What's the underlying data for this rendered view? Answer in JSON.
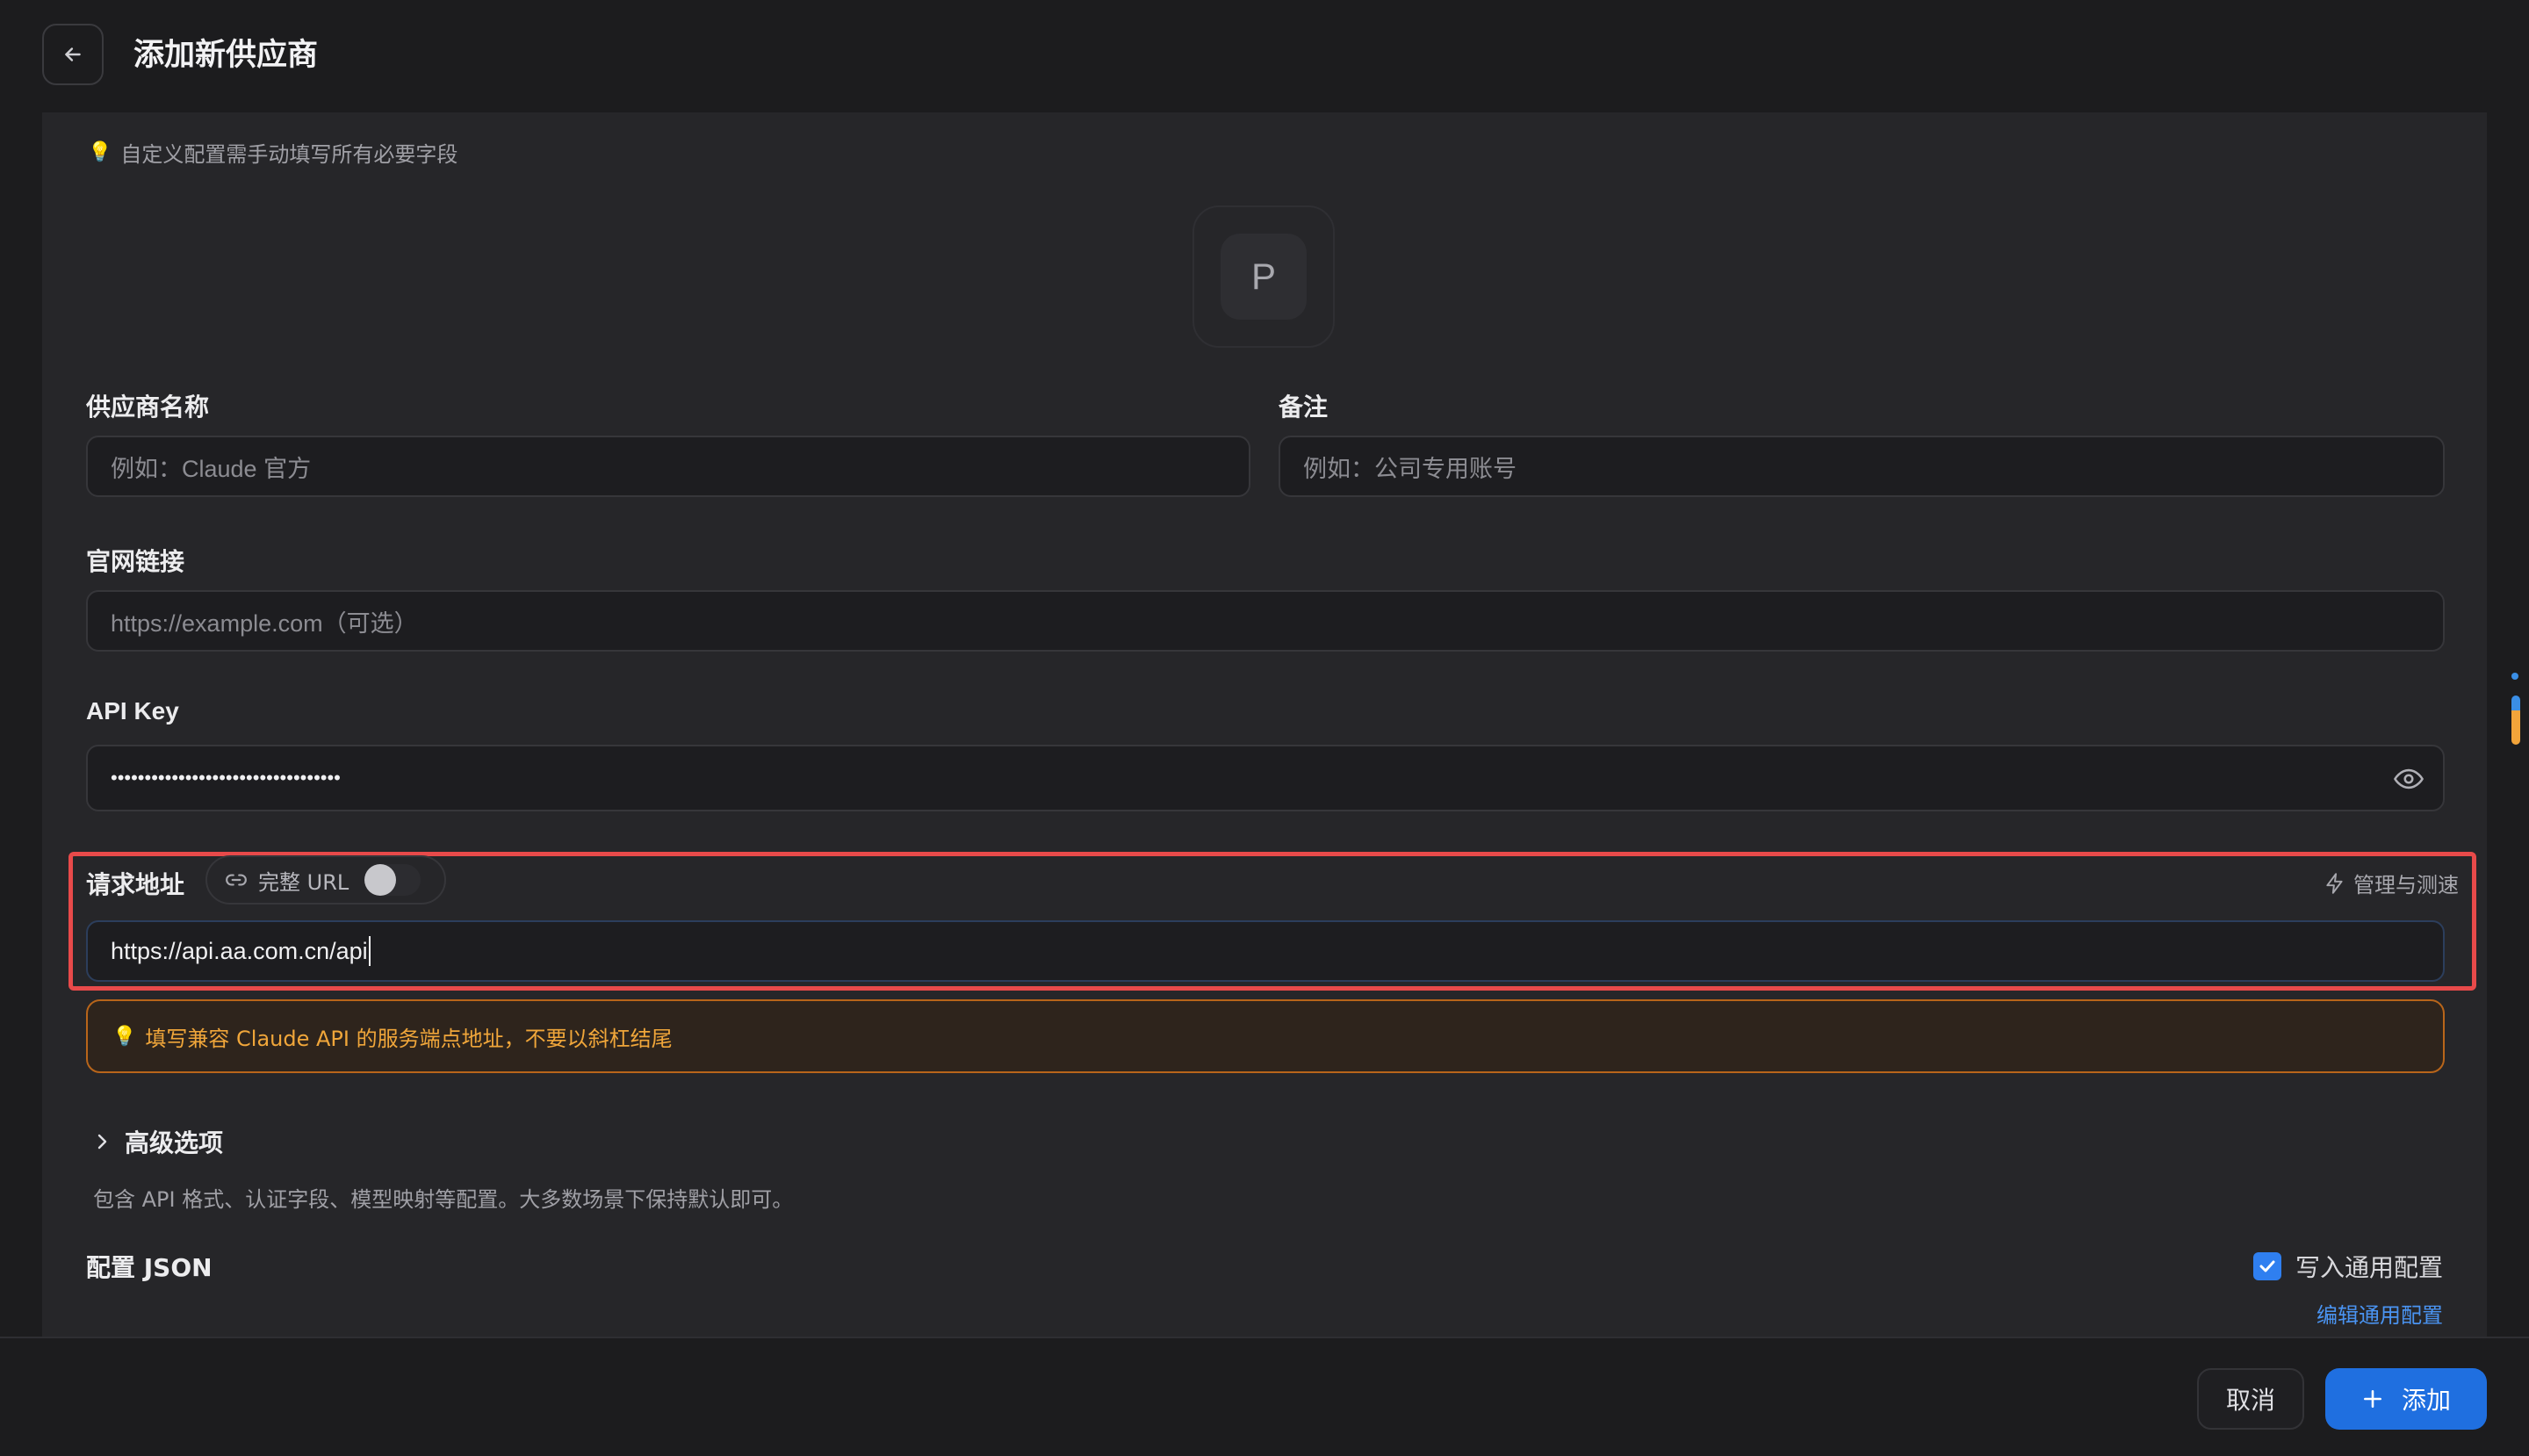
{
  "header": {
    "back_icon": "arrow-left-icon",
    "title": "添加新供应商"
  },
  "tip": {
    "icon": "lightbulb-icon",
    "text": "自定义配置需手动填写所有必要字段"
  },
  "avatar": {
    "letter": "P"
  },
  "form": {
    "provider_name": {
      "label": "供应商名称",
      "placeholder": "例如：Claude 官方",
      "value": ""
    },
    "notes": {
      "label": "备注",
      "placeholder": "例如：公司专用账号",
      "value": ""
    },
    "website": {
      "label": "官网链接",
      "placeholder": "https://example.com（可选）",
      "value": ""
    },
    "api_key": {
      "label": "API Key",
      "value": "••••••••••••••••••••••••••••••••••",
      "toggle_icon": "eye-icon"
    },
    "endpoint": {
      "label": "请求地址",
      "full_url_label": "完整 URL",
      "full_url_enabled": false,
      "link_icon": "link-icon",
      "manage_label": "管理与测速",
      "manage_icon": "lightning-icon",
      "value": "https://api.aa.com.cn/api",
      "hint": "填写兼容 Claude API 的服务端点地址，不要以斜杠结尾"
    }
  },
  "advanced": {
    "label": "高级选项",
    "description": "包含 API 格式、认证字段、模型映射等配置。大多数场景下保持默认即可。"
  },
  "config_json": {
    "label": "配置 JSON",
    "write_common_label": "写入通用配置",
    "write_common_checked": true,
    "edit_common_label": "编辑通用配置"
  },
  "footer": {
    "cancel_label": "取消",
    "add_label": "添加",
    "add_icon": "plus-icon"
  },
  "colors": {
    "accent": "#1f6fe0",
    "highlight_border": "#e84a4a",
    "warning": "#f0a63a",
    "link": "#4a94f2"
  }
}
